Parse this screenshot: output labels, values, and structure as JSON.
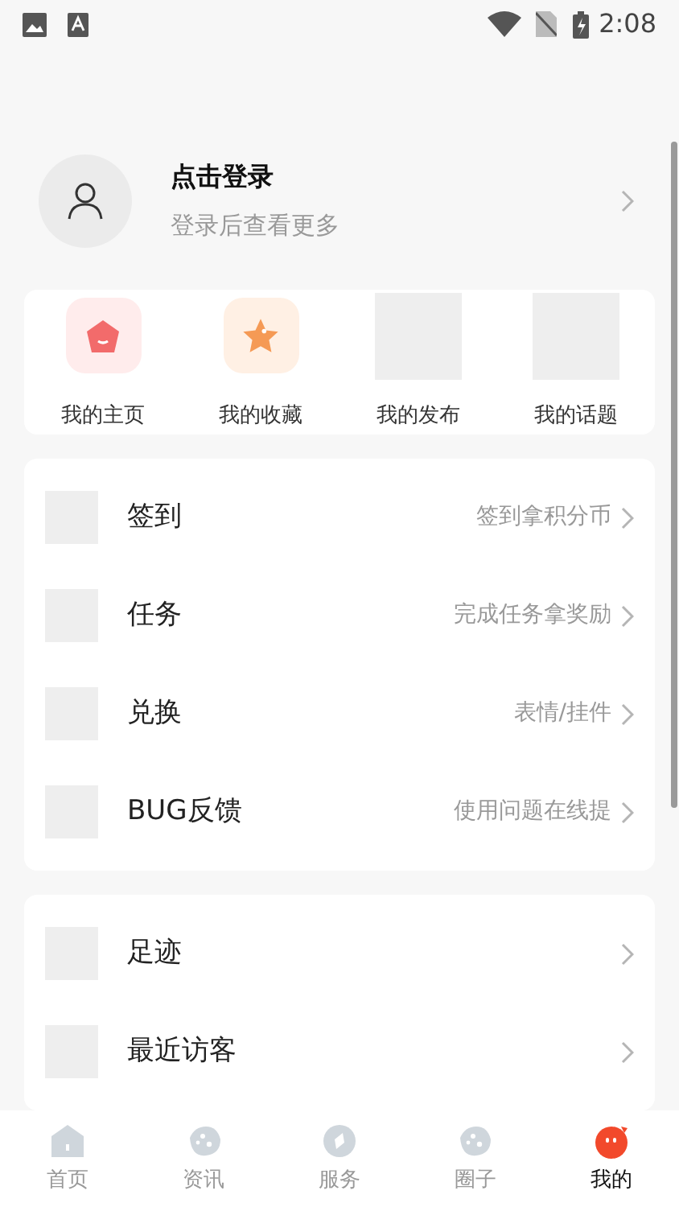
{
  "status_bar": {
    "time": "2:08"
  },
  "profile": {
    "title": "点击登录",
    "subtitle": "登录后查看更多"
  },
  "shortcuts": [
    {
      "label": "我的主页",
      "kind": "home"
    },
    {
      "label": "我的收藏",
      "kind": "star"
    },
    {
      "label": "我的发布",
      "kind": "placeholder"
    },
    {
      "label": "我的话题",
      "kind": "placeholder"
    }
  ],
  "menu_groups": [
    [
      {
        "title": "签到",
        "hint": "签到拿积分币"
      },
      {
        "title": "任务",
        "hint": "完成任务拿奖励"
      },
      {
        "title": "兑换",
        "hint": "表情/挂件"
      },
      {
        "title": "BUG反馈",
        "hint": "使用问题在线提"
      }
    ],
    [
      {
        "title": "足迹"
      },
      {
        "title": "最近访客"
      }
    ]
  ],
  "tab_bar": [
    {
      "label": "首页",
      "kind": "home",
      "selected": false
    },
    {
      "label": "资讯",
      "kind": "blob",
      "selected": false
    },
    {
      "label": "服务",
      "kind": "compass",
      "selected": false
    },
    {
      "label": "圈子",
      "kind": "blob",
      "selected": false
    },
    {
      "label": "我的",
      "kind": "face",
      "selected": true
    }
  ]
}
